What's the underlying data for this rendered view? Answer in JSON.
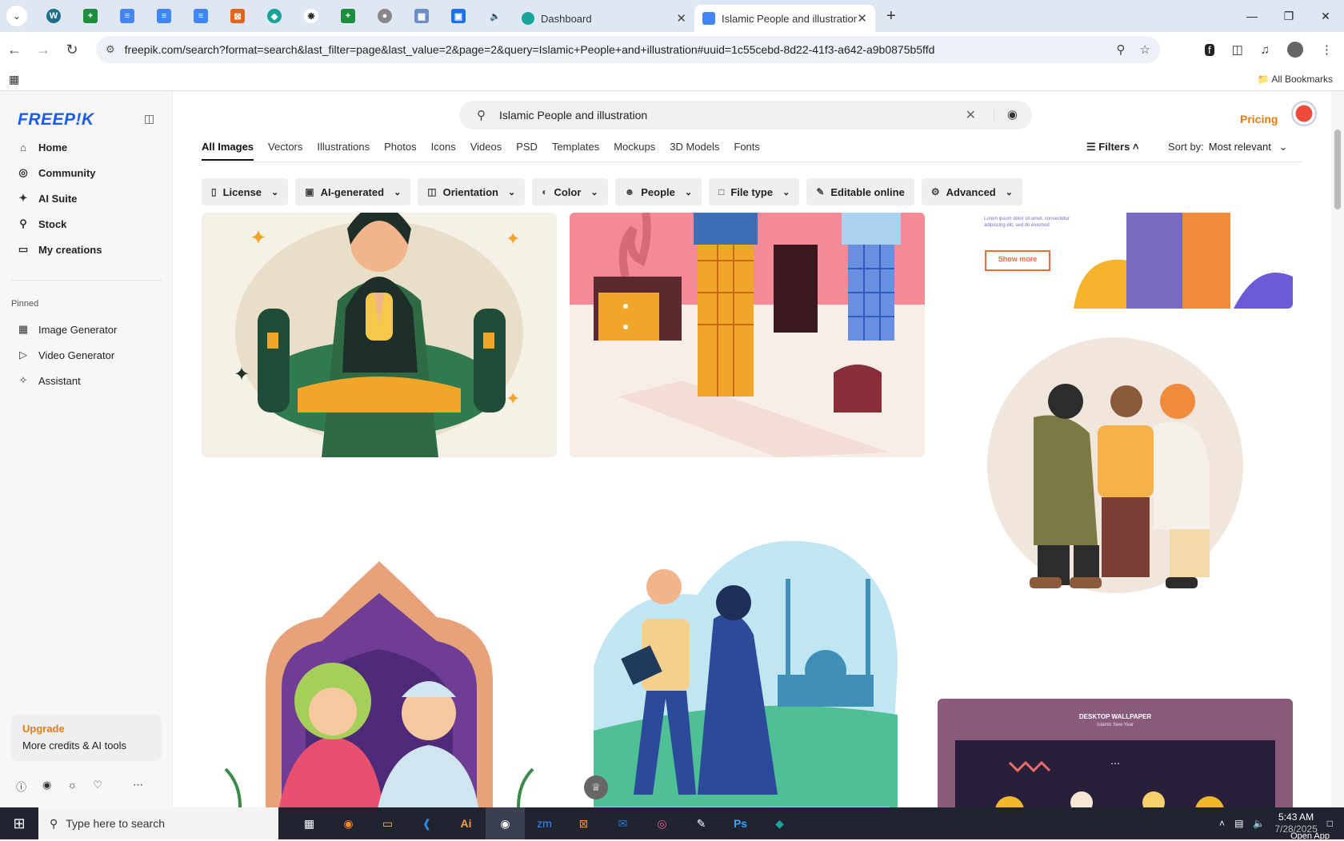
{
  "browser": {
    "tabs": [
      {
        "title": "Dashboard",
        "active": false
      },
      {
        "title": "Islamic People and illustration v",
        "active": true
      }
    ],
    "url": "freepik.com/search?format=search&last_filter=page&last_value=2&page=2&query=Islamic+People+and+illustration#uuid=1c55cebd-8d22-41f3-a642-a9b0875b5ffd",
    "all_bookmarks": "All Bookmarks"
  },
  "sidebar": {
    "logo": "FREEP!K",
    "nav": [
      {
        "label": "Home",
        "icon": "home-icon"
      },
      {
        "label": "Community",
        "icon": "globe-icon"
      },
      {
        "label": "AI Suite",
        "icon": "sparkle-icon"
      },
      {
        "label": "Stock",
        "icon": "search-icon"
      },
      {
        "label": "My creations",
        "icon": "folder-icon"
      }
    ],
    "pinned_label": "Pinned",
    "pinned": [
      {
        "label": "Image Generator",
        "icon": "image-icon"
      },
      {
        "label": "Video Generator",
        "icon": "video-icon"
      },
      {
        "label": "Assistant",
        "icon": "assistant-icon"
      }
    ],
    "upgrade": {
      "title": "Upgrade",
      "subtitle": "More credits & AI tools"
    }
  },
  "header": {
    "search_value": "Islamic People and illustration",
    "pricing": "Pricing"
  },
  "tabs": [
    "All Images",
    "Vectors",
    "Illustrations",
    "Photos",
    "Icons",
    "Videos",
    "PSD",
    "Templates",
    "Mockups",
    "3D Models",
    "Fonts"
  ],
  "filters_label": "Filters",
  "sort": {
    "label": "Sort by:",
    "value": "Most relevant"
  },
  "chips": [
    {
      "label": "License",
      "icon": "license-icon"
    },
    {
      "label": "AI-generated",
      "icon": "ai-icon"
    },
    {
      "label": "Orientation",
      "icon": "orientation-icon"
    },
    {
      "label": "Color",
      "icon": "palette-icon"
    },
    {
      "label": "People",
      "icon": "people-icon"
    },
    {
      "label": "File type",
      "icon": "file-icon"
    },
    {
      "label": "Editable online",
      "icon": "pencil-icon"
    },
    {
      "label": "Advanced",
      "icon": "gear-icon"
    }
  ],
  "cards": {
    "banner_text": "Lorem ipsum dolor sit amet, consectetur adipiscing elit, sed do eiusmod",
    "banner_button": "Show more",
    "wallpaper_title": "DESKTOP WALLPAPER",
    "wallpaper_sub": "Islamic New Year"
  },
  "taskbar": {
    "search_placeholder": "Type here to search",
    "time": "5:43 AM",
    "date": "7/28/2025",
    "open_app": "Open App"
  },
  "colors": {
    "brand": "#1b5cf0",
    "accent": "#e97b13"
  }
}
